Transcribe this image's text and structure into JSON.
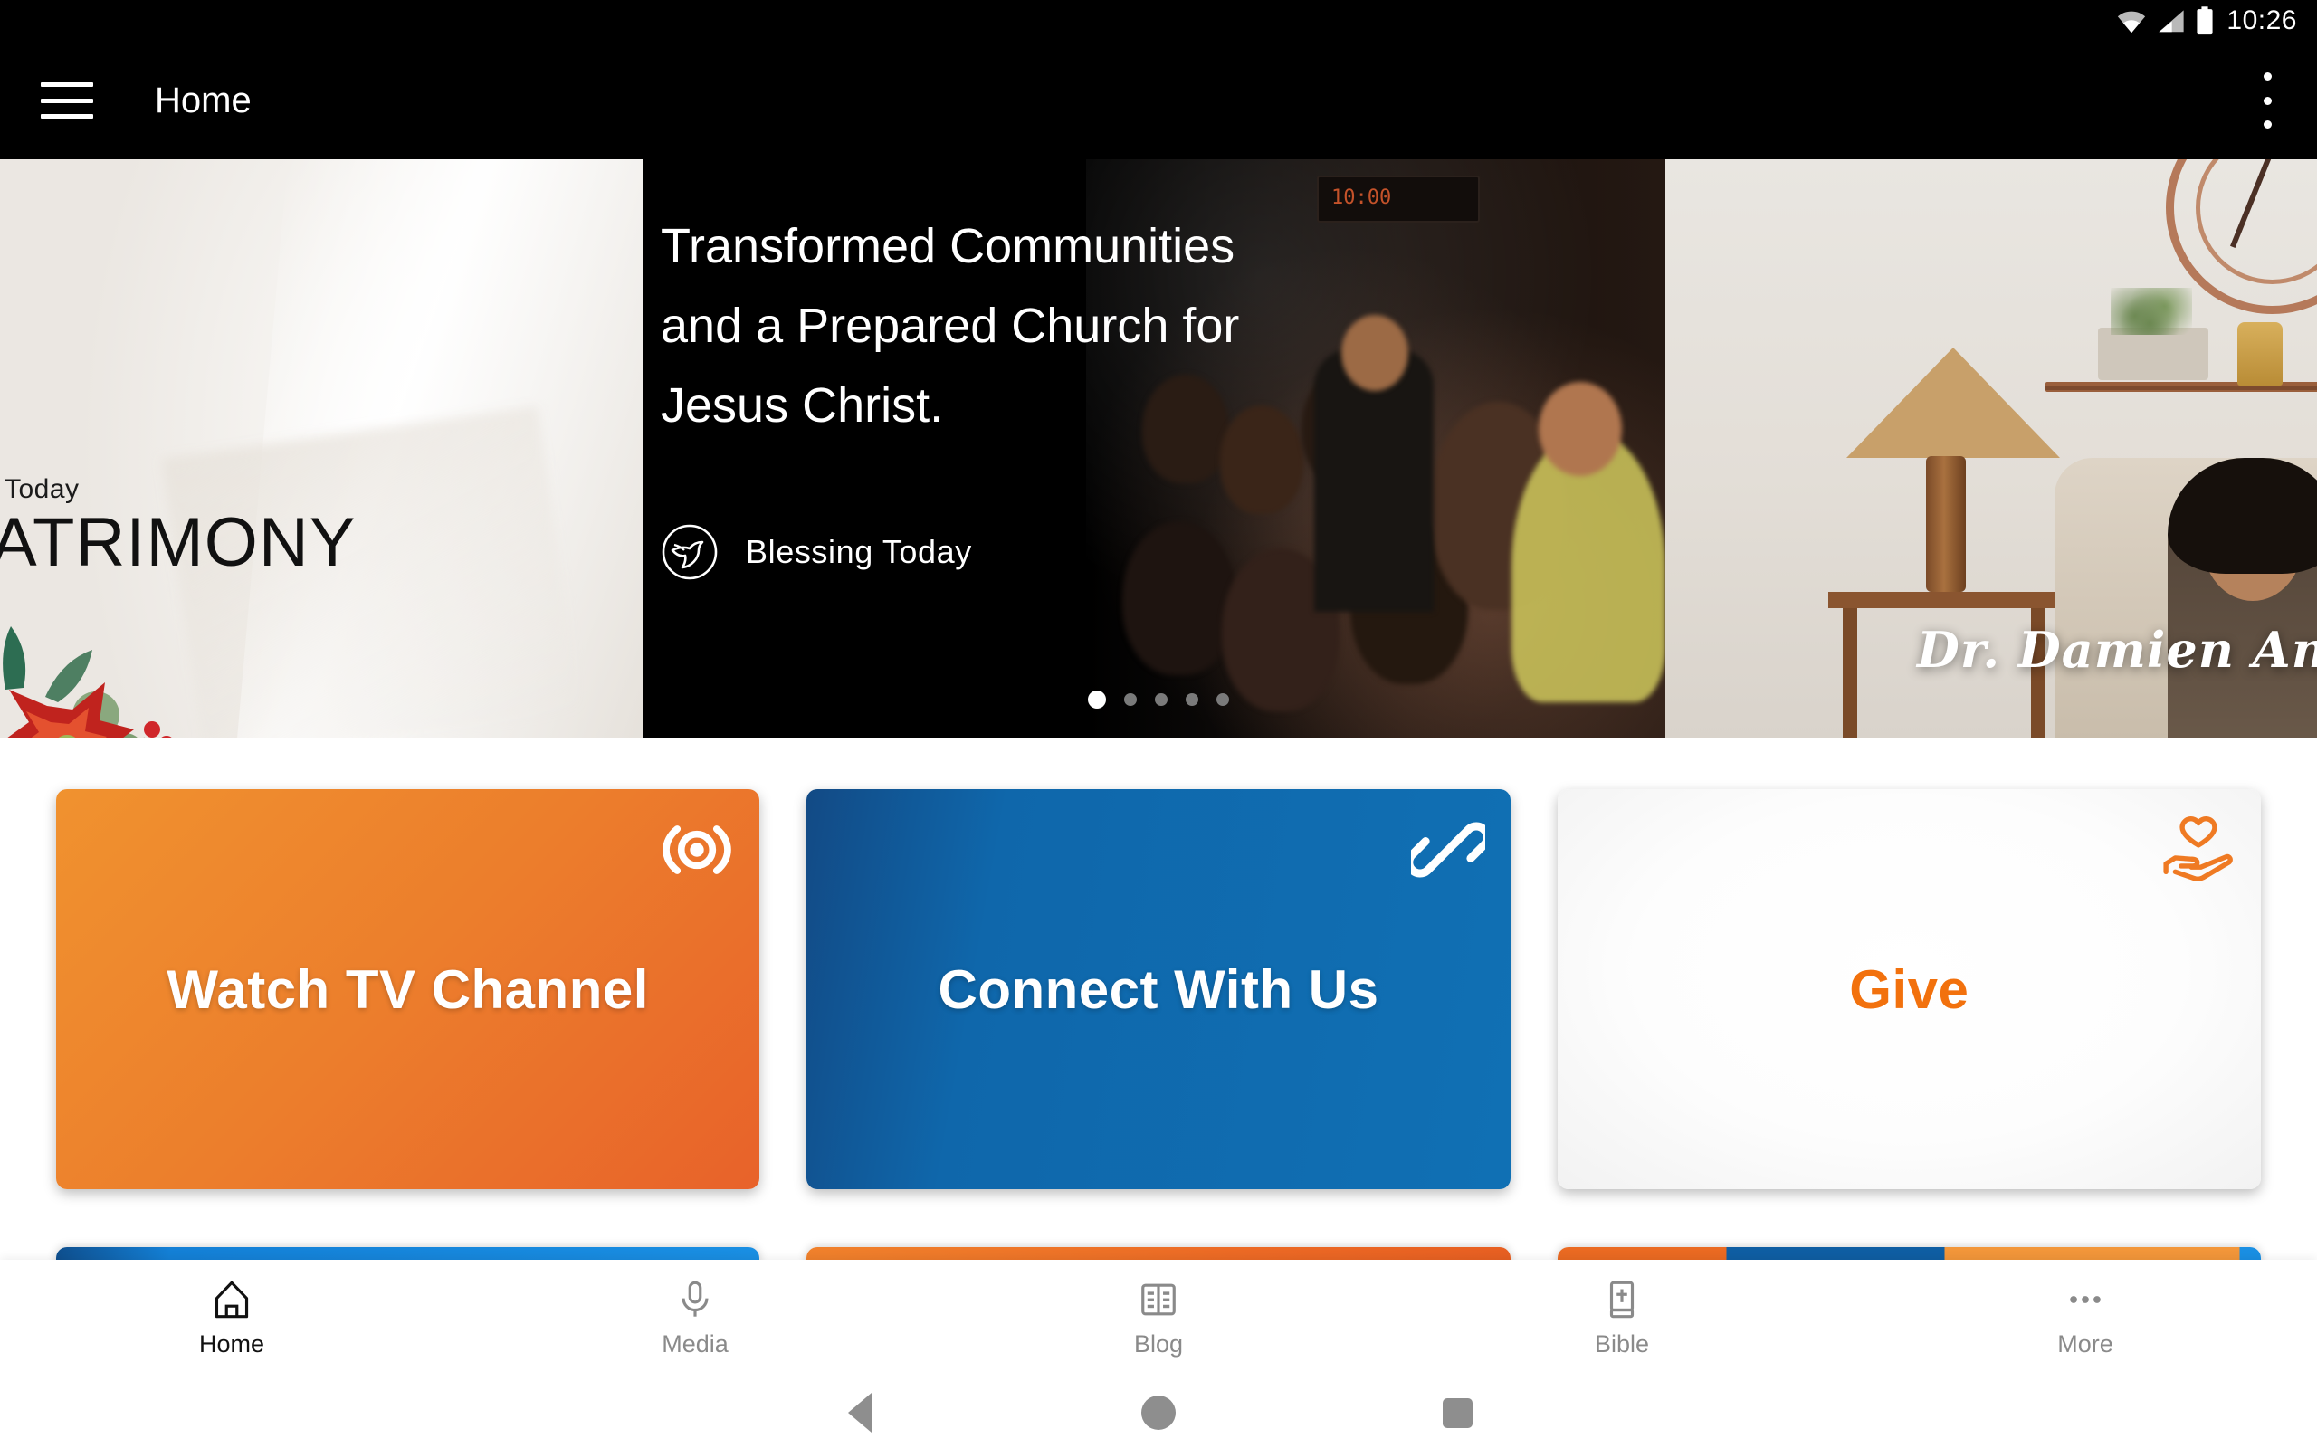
{
  "status_bar": {
    "time": "10:26",
    "icons": [
      "wifi-icon",
      "cellular-signal-icon",
      "battery-icon"
    ]
  },
  "toolbar": {
    "menu_icon": "hamburger-menu-icon",
    "title": "Home",
    "overflow_icon": "more-vertical-icon"
  },
  "carousel": {
    "total_slides": 5,
    "active_index": 0,
    "slides": [
      {
        "id": "matrimony",
        "kicker": "Today",
        "title": "ATRIMONY",
        "position": "left-partial"
      },
      {
        "id": "transformed-communities",
        "headline_lines": [
          "Transformed Communities",
          "and a Prepared Church for",
          "Jesus Christ."
        ],
        "brand_name": "Blessing Today",
        "brand_icon": "dove-logo-icon",
        "position": "center-active"
      },
      {
        "id": "damien-antony",
        "caption": "Dr. Damien Antony &",
        "position": "right-partial"
      }
    ]
  },
  "cards": [
    {
      "id": "watch-tv-channel",
      "label": "Watch TV Channel",
      "icon": "broadcast-icon",
      "accent": "#ec7e2c",
      "text_color": "#ffffff"
    },
    {
      "id": "connect-with-us",
      "label": "Connect With Us",
      "icon": "link-chain-icon",
      "accent": "#0f67ab",
      "text_color": "#ffffff"
    },
    {
      "id": "give",
      "label": "Give",
      "icon": "hand-holding-heart-icon",
      "accent": "#f2710d",
      "text_color": "#f2710d"
    }
  ],
  "cards_row2": [
    {
      "id": "card-row2-blue",
      "accent": "#1480d6"
    },
    {
      "id": "card-row2-orange",
      "accent": "#ec6a25"
    },
    {
      "id": "card-row2-mixed",
      "accent": "#ea6a22"
    }
  ],
  "bottom_nav": {
    "active": "Home",
    "items": [
      {
        "label": "Home",
        "icon": "home-icon"
      },
      {
        "label": "Media",
        "icon": "microphone-icon"
      },
      {
        "label": "Blog",
        "icon": "article-book-icon"
      },
      {
        "label": "Bible",
        "icon": "bible-book-icon"
      },
      {
        "label": "More",
        "icon": "more-horizontal-icon"
      }
    ]
  },
  "system_nav": {
    "items": [
      {
        "name": "back",
        "icon": "triangle-back-icon"
      },
      {
        "name": "home",
        "icon": "circle-home-icon"
      },
      {
        "name": "recents",
        "icon": "square-recents-icon"
      }
    ]
  }
}
